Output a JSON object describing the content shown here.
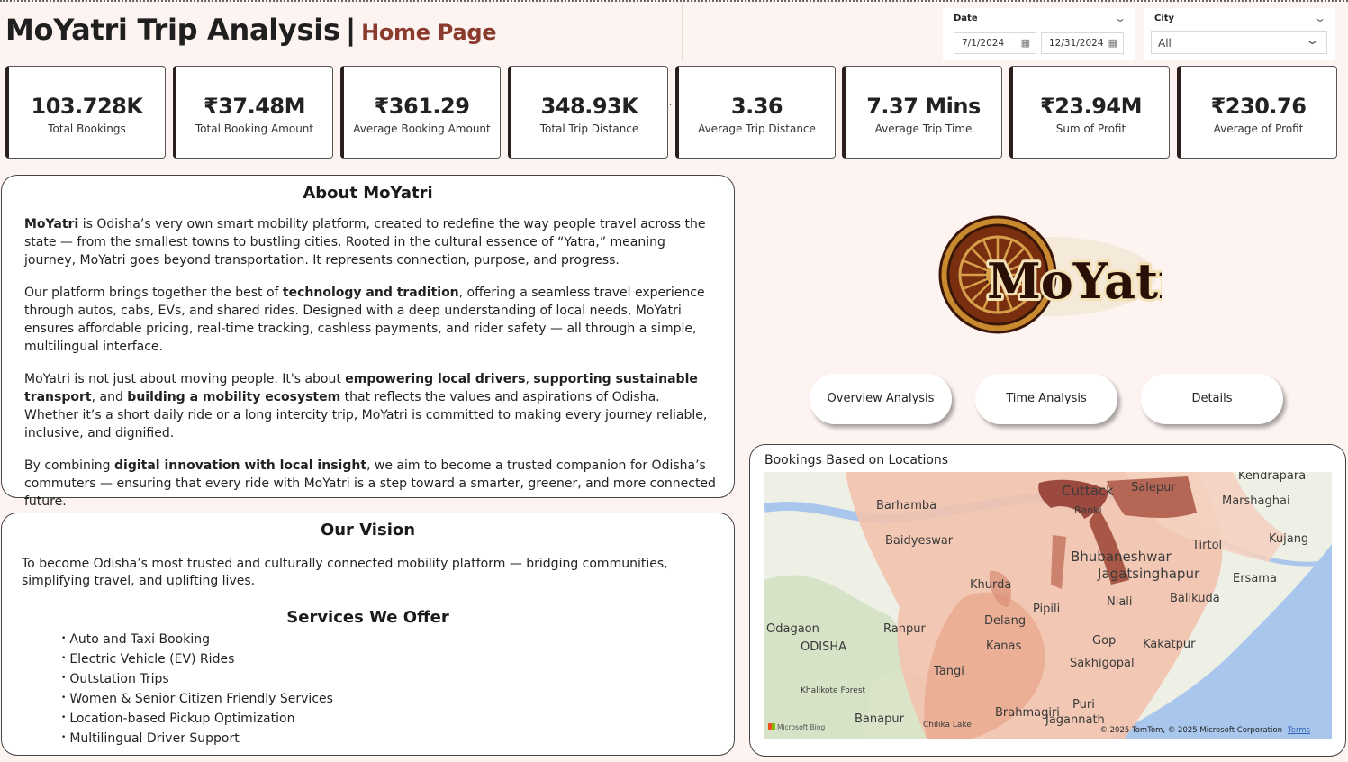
{
  "header": {
    "title": "MoYatri Trip Analysis",
    "separator": "|",
    "subtitle": "Home Page"
  },
  "filters": {
    "date_label": "Date",
    "date_start": "7/1/2024",
    "date_end": "12/31/2024",
    "city_label": "City",
    "city_value": "All"
  },
  "kpis": [
    {
      "value": "103.728K",
      "label": "Total Bookings"
    },
    {
      "value": "₹37.48M",
      "label": "Total Booking Amount"
    },
    {
      "value": "₹361.29",
      "label": "Average Booking Amount"
    },
    {
      "value": "348.93K",
      "label": "Total Trip Distance"
    },
    {
      "value": "3.36",
      "label": "Average Trip Distance"
    },
    {
      "value": "7.37 Mins",
      "label": "Average Trip Time"
    },
    {
      "value": "₹23.94M",
      "label": "Sum of Profit"
    },
    {
      "value": "₹230.76",
      "label": "Average of Profit"
    }
  ],
  "about": {
    "heading": "About MoYatri",
    "p1_bold": "MoYatri",
    "p1_text": " is Odisha’s very own smart mobility platform, created to redefine the way people travel across the state — from the smallest towns to bustling cities. Rooted in the cultural essence of “Yatra,” meaning journey, MoYatri goes beyond transportation. It represents connection, purpose, and progress.",
    "p2_a": "Our platform brings together the best of ",
    "p2_bold": "technology and tradition",
    "p2_b": ", offering a seamless travel experience through autos, cabs, EVs, and shared rides. Designed with a deep understanding of local needs, MoYatri ensures affordable pricing, real-time tracking, cashless payments, and rider safety — all through a simple, multilingual interface.",
    "p3_a": "MoYatri is not just about moving people. It's about ",
    "p3_bold1": "empowering local drivers",
    "p3_b": ", ",
    "p3_bold2": "supporting sustainable transport",
    "p3_c": ", and ",
    "p3_bold3": "building a mobility ecosystem",
    "p3_d": " that reflects the values and aspirations of Odisha. Whether it’s a short daily ride or a long intercity trip, MoYatri is committed to making every journey reliable, inclusive, and dignified.",
    "p4_a": "By combining ",
    "p4_bold": "digital innovation with local insight",
    "p4_b": ", we aim to become a trusted companion for Odisha’s commuters — ensuring that every ride with MoYatri is a step toward a smarter, greener, and more connected future."
  },
  "vision": {
    "heading": "Our Vision",
    "text": "To become Odisha’s most trusted and culturally connected mobility platform — bridging communities, simplifying travel, and uplifting lives.",
    "services_heading": "Services We Offer",
    "services": [
      "Auto and Taxi Booking",
      "Electric Vehicle (EV) Rides",
      "Outstation Trips",
      "Women & Senior Citizen Friendly Services",
      "Location-based Pickup Optimization",
      "Multilingual Driver Support"
    ]
  },
  "logo": {
    "text": "MoYatri"
  },
  "nav": {
    "overview": "Overview Analysis",
    "time": "Time Analysis",
    "details": "Details"
  },
  "map": {
    "title": "Bookings Based on Locations",
    "places": [
      "Kendrapara",
      "Salepur",
      "Barhamba",
      "Cuttack",
      "Marshaghai",
      "Banki",
      "Baidyeswar",
      "Tirtol",
      "Kujang",
      "Bhubaneshwar",
      "Jagatsinghapur",
      "Ersama",
      "Khurda",
      "Balikuda",
      "Niali",
      "Odagaon",
      "Delang",
      "Pipili",
      "Ranpur",
      "ODISHA",
      "Kanas",
      "Gop",
      "Kakatpur",
      "Tangi",
      "Sakhigopal",
      "Khalikote Forest",
      "Puri",
      "Banapur",
      "Chilika Lake",
      "Brahmagiri",
      "Jagannath"
    ],
    "copyright": "© 2025 TomTom, © 2025 Microsoft Corporation",
    "terms": "Terms",
    "provider": "Microsoft Bing"
  }
}
